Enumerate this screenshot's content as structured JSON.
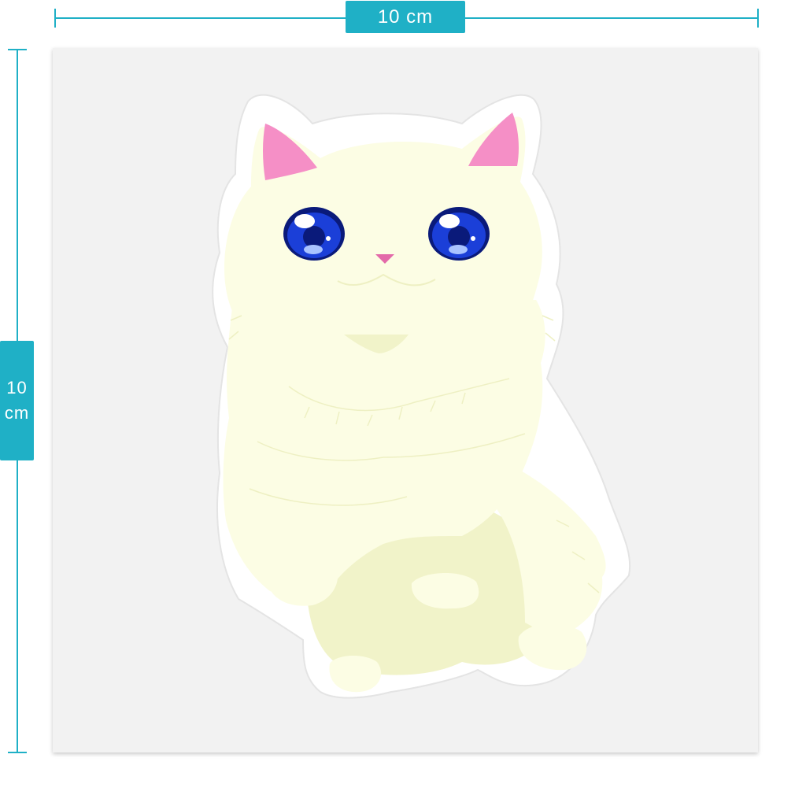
{
  "dimensions": {
    "width_label": "10 cm",
    "height_label_value": "10",
    "height_label_unit": "cm"
  },
  "colors": {
    "accent": "#1fb0c6",
    "board": "#f2f2f2",
    "cat_fur": "#fcfde4",
    "cat_shadow": "#f1f3c9",
    "fur_line": "#eef0c3",
    "ear_inner": "#f58fc6",
    "eye_blue": "#1b3fd8",
    "eye_dark": "#0a1a7a",
    "nose": "#e36aa9"
  },
  "sticker": {
    "subject": "white-fluffy-cat"
  }
}
